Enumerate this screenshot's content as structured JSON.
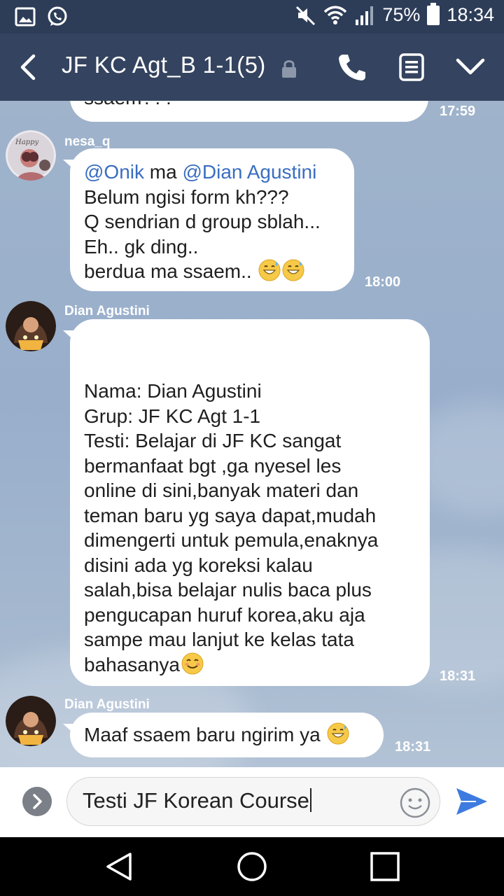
{
  "status_bar": {
    "battery": "75%",
    "time": "18:34",
    "icons": [
      "gallery-icon",
      "whatsapp-icon",
      "mute-icon",
      "wifi-icon",
      "signal-icon",
      "battery-icon"
    ]
  },
  "header": {
    "title": "JF KC Agt_B 1-1(5)",
    "icons": [
      "back-icon",
      "lock-icon",
      "call-icon",
      "notes-icon",
      "chevron-down-icon"
    ]
  },
  "messages": [
    {
      "sender": "",
      "lines": [
        "ssaem???"
      ],
      "time": "17:59"
    },
    {
      "sender": "nesa_q",
      "lines": [
        "@Onik ma @Dian Agustini",
        "Belum ngisi form kh???",
        "Q sendrian d group sblah...",
        "Eh.. gk ding..",
        "berdua ma ssaem.."
      ],
      "mentions": [
        "@Onik",
        "@Dian Agustini"
      ],
      "time": "18:00"
    },
    {
      "sender": "Dian Agustini",
      "lines": [
        "",
        "",
        "Nama: Dian Agustini",
        "Grup: JF KC Agt 1-1",
        "Testi: Belajar di JF KC sangat",
        "bermanfaat bgt ,ga nyesel les",
        "online di sini,banyak materi dan",
        "teman baru yg saya dapat,mudah",
        "dimengerti untuk pemula,enaknya",
        "disini ada yg koreksi kalau",
        "salah,bisa belajar nulis baca plus",
        "pengucapan huruf korea,aku aja",
        "sampe mau lanjut ke kelas tata",
        "bahasanya"
      ],
      "time": "18:31"
    },
    {
      "sender": "Dian Agustini",
      "lines": [
        "Maaf ssaem baru ngirim ya"
      ],
      "time": "18:31"
    }
  ],
  "composer": {
    "value": "Testi JF Korean Course",
    "icons": [
      "expand-icon",
      "emoji-icon",
      "send-icon"
    ]
  },
  "nav_bar": {
    "icons": [
      "nav-back-icon",
      "nav-home-icon",
      "nav-recent-icon"
    ]
  },
  "colors": {
    "header": "#34435f",
    "status_bar": "#2d3d58",
    "mention": "#3a6ec0",
    "send": "#3d7be0"
  }
}
